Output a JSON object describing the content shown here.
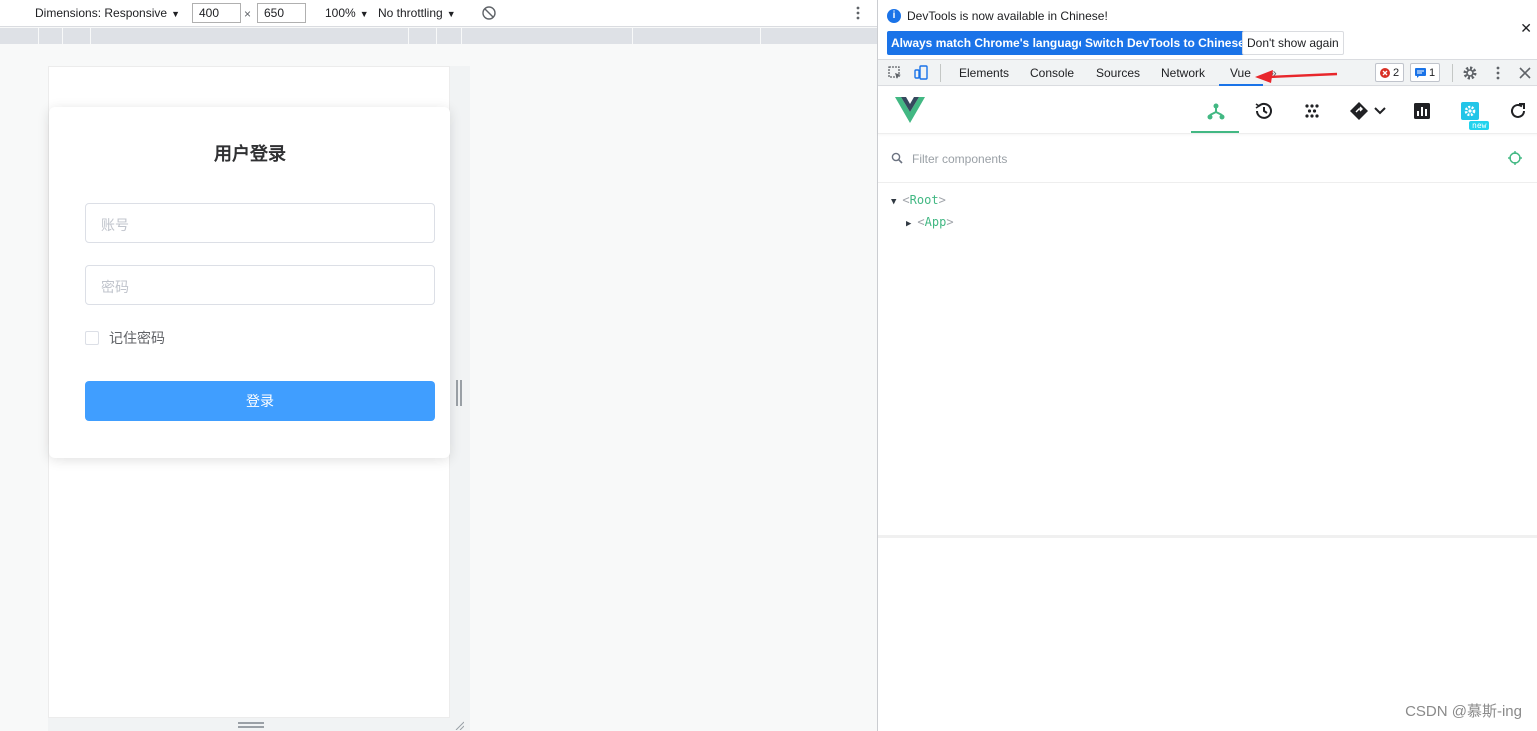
{
  "device_toolbar": {
    "dimensions_label": "Dimensions: Responsive",
    "width_value": "400",
    "times": "×",
    "height_value": "650",
    "zoom": "100%",
    "throttling": "No throttling"
  },
  "login": {
    "title": "用户登录",
    "username_placeholder": "账号",
    "password_placeholder": "密码",
    "remember_label": "记住密码",
    "submit_label": "登录"
  },
  "infobar": {
    "message": "DevTools is now available in Chinese!",
    "btn_match": "Always match Chrome's language",
    "btn_switch": "Switch DevTools to Chinese",
    "btn_dismiss": "Don't show again"
  },
  "tabs": {
    "elements": "Elements",
    "console": "Console",
    "sources": "Sources",
    "network": "Network",
    "vue": "Vue",
    "more": "»",
    "errors_count": "2",
    "messages_count": "1"
  },
  "vue_panel": {
    "new_badge": "new",
    "filter_placeholder": "Filter components",
    "tree": [
      {
        "name": "Root"
      },
      {
        "name": "App"
      }
    ]
  },
  "colors": {
    "vue_green": "#42b883",
    "primary_blue": "#409eff",
    "devtools_blue": "#1a73e8",
    "annotation_red": "#e8262b"
  },
  "watermark": "CSDN @慕斯-ing"
}
